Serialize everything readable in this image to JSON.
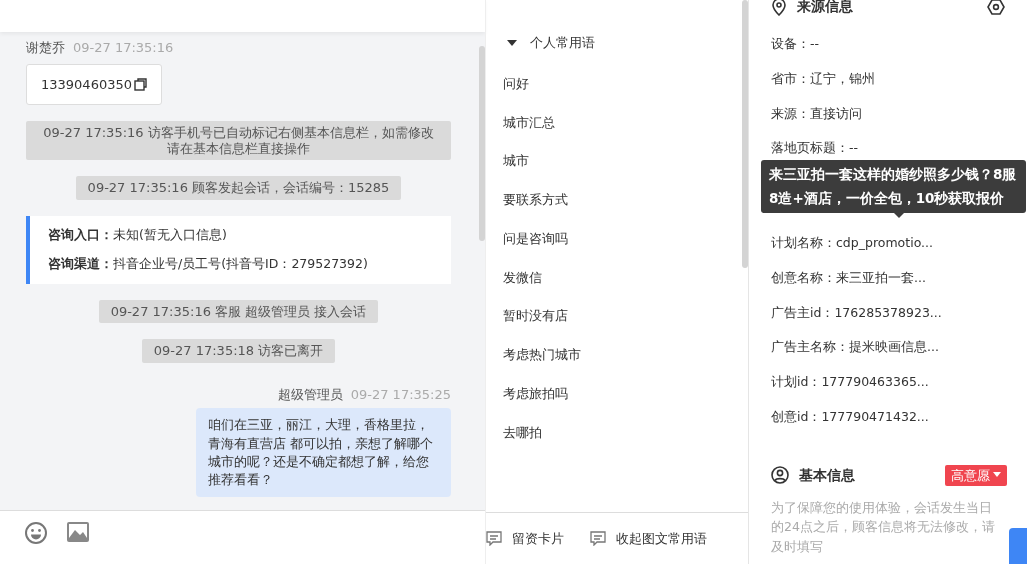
{
  "chat": {
    "messages": [
      {
        "kind": "visitor",
        "sender": "谢楚乔",
        "time": "09-27 17:35:16",
        "text": "13390460350"
      },
      {
        "kind": "system",
        "text": "09-27 17:35:16 访客手机号已自动标记右侧基本信息栏，如需修改请在基本信息栏直接操作"
      },
      {
        "kind": "system",
        "text": "09-27 17:35:16 顾客发起会话，会话编号：15285"
      },
      {
        "kind": "info",
        "rows": [
          {
            "label": "咨询入口：",
            "value": "未知(暂无入口信息)"
          },
          {
            "label": "咨询渠道：",
            "value": "抖音企业号/员工号(抖音号ID：279527392)"
          }
        ]
      },
      {
        "kind": "system",
        "text": "09-27 17:35:16 客服 超级管理员 接入会话"
      },
      {
        "kind": "system",
        "text": "09-27 17:35:18 访客已离开"
      },
      {
        "kind": "agent",
        "sender": "超级管理员",
        "time": "09-27 17:35:25",
        "text": "咱们在三亚，丽江，大理，香格里拉，青海有直营店 都可以拍，亲想了解哪个城市的呢？还是不确定都想了解，给您推荐看看？"
      }
    ]
  },
  "phrases": {
    "group": {
      "title": "个人常用语",
      "expanded": true
    },
    "items": [
      "问好",
      "城市汇总",
      "城市",
      "要联系方式",
      "问是咨询吗",
      "发微信",
      "暂时没有店",
      "考虑热门城市",
      "考虑旅拍吗",
      "去哪拍"
    ]
  },
  "phrase_actions": [
    "留资卡片",
    "收起图文常用语"
  ],
  "source_info": {
    "title": "来源信息",
    "rows_before": [
      "设备：--",
      "省市：辽宁，锦州",
      "来源：直接访问",
      "落地页标题：--"
    ],
    "tooltip": "来三亚拍一套这样的婚纱照多少钱？8服8造+酒店，一价全包，10秒获取报价",
    "rows_after": [
      "计划名称：cdp_promotio...",
      "创意名称：来三亚拍一套...",
      "广告主id：176285378923...",
      "广告主名称：提米映画信息...",
      "计划id：177790463365...",
      "创意id：177790471432..."
    ]
  },
  "basic_info": {
    "title": "基本信息",
    "intent": "高意愿",
    "note": "为了保障您的使用体验，会话发生当日的24点之后，顾客信息将无法修改，请及时填写"
  }
}
